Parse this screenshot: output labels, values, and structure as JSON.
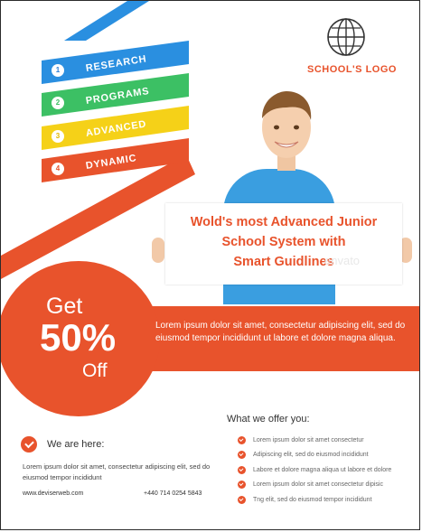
{
  "logo": {
    "label": "SCHOOL'S LOGO",
    "icon": "globe-icon",
    "color": "#e8532c"
  },
  "ribbons": [
    {
      "number": "1",
      "label": "RESEARCH",
      "color": "#2a8fe0"
    },
    {
      "number": "2",
      "label": "PROGRAMS",
      "color": "#3cc064"
    },
    {
      "number": "3",
      "label": "ADVANCED",
      "color": "#f5d118"
    },
    {
      "number": "4",
      "label": "DYNAMIC",
      "color": "#e8532c"
    }
  ],
  "headline": {
    "line1": "Wold's most Advanced Junior",
    "line2": "School System with",
    "line3": "Smart Guidlines",
    "watermark": "envato"
  },
  "promo": {
    "get": "Get",
    "percent": "50%",
    "off": "Off",
    "description": "Lorem ipsum dolor sit amet, consectetur adipiscing elit, sed do eiusmod tempor incididunt ut labore et dolore magna aliqua.",
    "color": "#e8532c"
  },
  "offer": {
    "title": "What we offer you:",
    "items": [
      "Lorem ipsum dolor sit amet consectetur",
      "Adipiscing elit, sed do eiusmod  incididunt",
      "Labore et dolore magna aliqua ut labore et dolore",
      "Lorem ipsum dolor sit amet consectetur dipisic",
      "Tng elit, sed do eiusmod tempor incididunt"
    ]
  },
  "here": {
    "title": "We are here:",
    "description": "Lorem ipsum dolor sit amet, consectetur adipiscing elit, sed do eiusmod tempor incididunt",
    "website": "www.deviserweb.com",
    "phone": "+440 714 0254 5843"
  }
}
